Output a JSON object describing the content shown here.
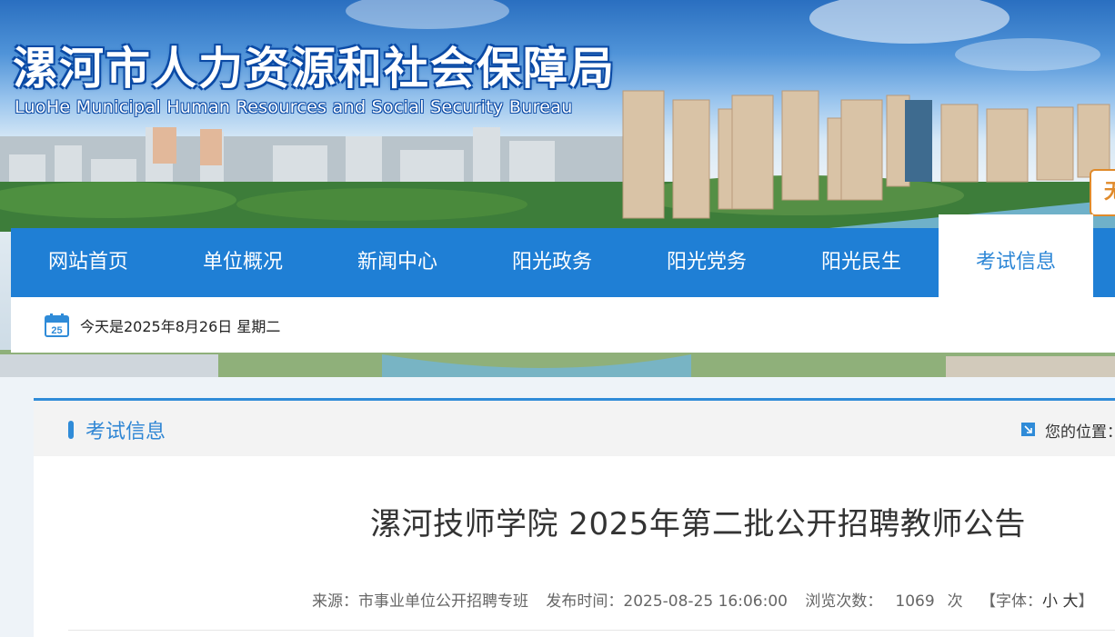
{
  "header": {
    "bureau_name_cn": "漯河市人力资源和社会保障局",
    "bureau_name_en": "LuoHe Municipal Human Resources and Social Security Bureau",
    "side_chip_text": "无"
  },
  "nav": {
    "items": [
      {
        "label": "网站首页"
      },
      {
        "label": "单位概况"
      },
      {
        "label": "新闻中心"
      },
      {
        "label": "阳光政务"
      },
      {
        "label": "阳光党务"
      },
      {
        "label": "阳光民生"
      },
      {
        "label": "考试信息"
      }
    ],
    "active_index": 6
  },
  "datebar": {
    "icon": "calendar-icon",
    "calendar_day": "25",
    "text": "今天是2025年8月26日 星期二"
  },
  "section": {
    "title": "考试信息",
    "location_label": "您的位置：",
    "location_icon": "arrow-corner-icon"
  },
  "article": {
    "title": "漯河技师学院 2025年第二批公开招聘教师公告",
    "source": "来源：市事业单位公开招聘专班",
    "publish_time": "发布时间：2025-08-25 16:06:00",
    "views_label": "浏览次数：",
    "views_count": "1069",
    "views_unit": "次",
    "font_label": "【字体：",
    "font_small": "小",
    "font_large": "大",
    "font_close": "】"
  },
  "colors": {
    "nav_bg": "#1f7fd5",
    "accent": "#2f8bd8",
    "title_text": "#333333",
    "side_chip": "#e08a2a"
  }
}
